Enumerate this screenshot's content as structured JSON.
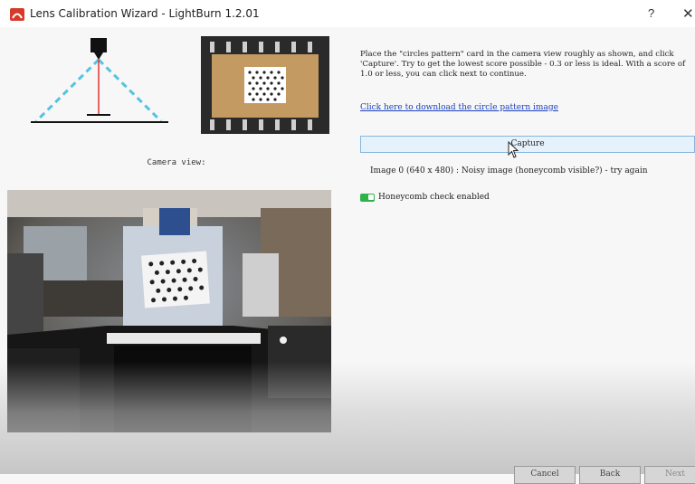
{
  "window": {
    "title": "Lens Calibration Wizard - LightBurn 1.2.01",
    "help": "?",
    "close": "✕"
  },
  "left": {
    "camera_label": "Camera view:"
  },
  "right": {
    "instructions": "Place the \"circles pattern\" card in the camera view roughly as shown, and click 'Capture'. Try to get the lowest score possible - 0.3 or less is ideal.  With a score of 1.0 or less, you can click next to continue.",
    "download_link": "Click here to download the circle pattern image",
    "capture_label": "Capture",
    "status": "Image 0 (640 x 480) : Noisy image (honeycomb visible?) - try again",
    "honeycomb_label": "Honeycomb check enabled",
    "honeycomb_enabled": true
  },
  "footer": {
    "cancel": "Cancel",
    "back": "Back",
    "next": "Next"
  },
  "colors": {
    "accent_button": "#e5f1fb",
    "toggle_on": "#2fb24a",
    "link": "#1a3fbf"
  }
}
